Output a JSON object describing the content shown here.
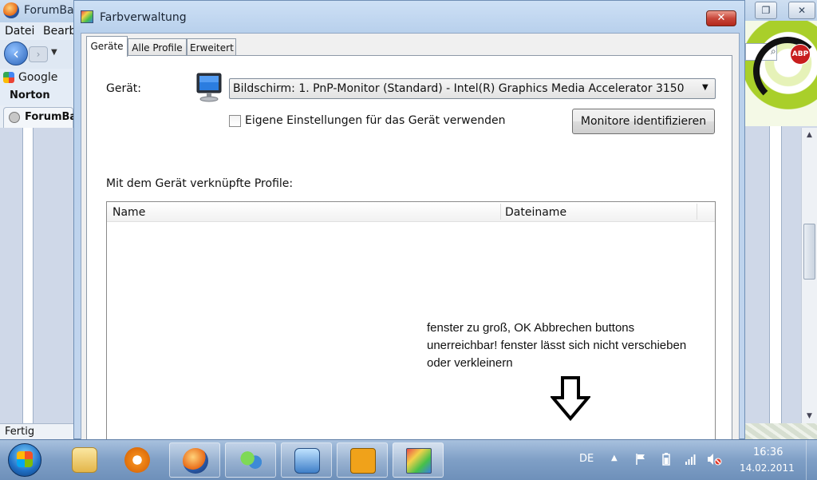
{
  "browser": {
    "title": "ForumBa",
    "menu": [
      "Datei",
      "Bearb"
    ],
    "toolbar_google_label": "Google",
    "norton_label": "Norton",
    "tab_label": "ForumBa",
    "status": "Fertig",
    "abp_label": "ABP"
  },
  "dialog": {
    "title": "Farbverwaltung",
    "close_label": "✕",
    "tabs": [
      "Geräte",
      "Alle Profile",
      "Erweitert"
    ],
    "active_tab": 0,
    "device_label": "Gerät:",
    "device_value": "Bildschirm: 1. PnP-Monitor (Standard) - Intel(R) Graphics Media Accelerator 3150",
    "checkbox_label": "Eigene Einstellungen für das Gerät verwenden",
    "checkbox_checked": false,
    "identify_button": "Monitore identifizieren",
    "profiles_label": "Mit dem Gerät verknüpfte Profile:",
    "columns": [
      "Name",
      "Dateiname"
    ],
    "rows": []
  },
  "annotation": {
    "lines": [
      "fenster zu groß, OK Abbrechen buttons",
      "unerreichbar! fenster lässt sich nicht verschieben",
      "oder verkleinern"
    ]
  },
  "taskbar": {
    "language": "DE",
    "time": "16:36",
    "date": "14.02.2011",
    "apps": [
      "explorer-icon",
      "media-player-icon",
      "firefox-icon",
      "messenger-icon",
      "control-panel-icon",
      "network-globe-icon",
      "color-management-icon"
    ]
  },
  "colors": {
    "dialog_frame": "#b8d0ec",
    "close_button": "#c8473a",
    "taskbar": "#7f9fc6"
  }
}
